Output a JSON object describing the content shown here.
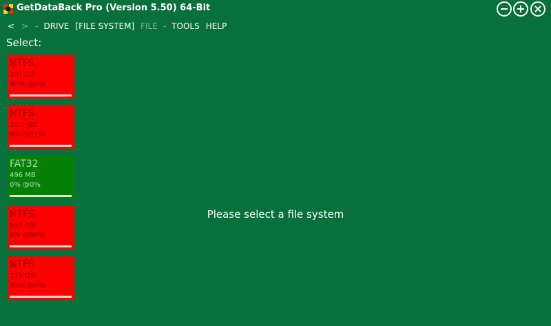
{
  "titlebar": {
    "title": "GetDataBack Pro (Version 5.50) 64-Bit"
  },
  "menu": {
    "back": "<",
    "forward": ">",
    "separator": "-",
    "drive": "DRIVE",
    "file_system": "[FILE SYSTEM]",
    "file": "FILE",
    "tools": "TOOLS",
    "help": "HELP"
  },
  "select_label": "Select:",
  "partitions": [
    {
      "fs": "NTFS",
      "size": "107 GB",
      "stats": "90% @0%",
      "color": "#ff0000",
      "text_color": "#8b0000",
      "fill": 0.9
    },
    {
      "fs": "NTFS",
      "size": "10.3 GB",
      "stats": "8% @91%",
      "color": "#ff0000",
      "text_color": "#8b0000",
      "fill": 0.9
    },
    {
      "fs": "FAT32",
      "size": "496 MB",
      "stats": "0% @0%",
      "color": "#058005",
      "text_color": "#b8d8b8",
      "fill": 1.0
    },
    {
      "fs": "NTFS",
      "size": "853 MB",
      "stats": "0% @90%",
      "color": "#ff0000",
      "text_color": "#8b0000",
      "fill": 0.9
    },
    {
      "fs": "NTFS",
      "size": "119 GB",
      "stats": "99% @0%",
      "color": "#ff0000",
      "text_color": "#8b0000",
      "fill": 1.0
    }
  ],
  "main_message": "Please select a file system",
  "colors": {
    "background": "#08703a",
    "bad_partition": "#ff0000",
    "good_partition": "#058005"
  }
}
